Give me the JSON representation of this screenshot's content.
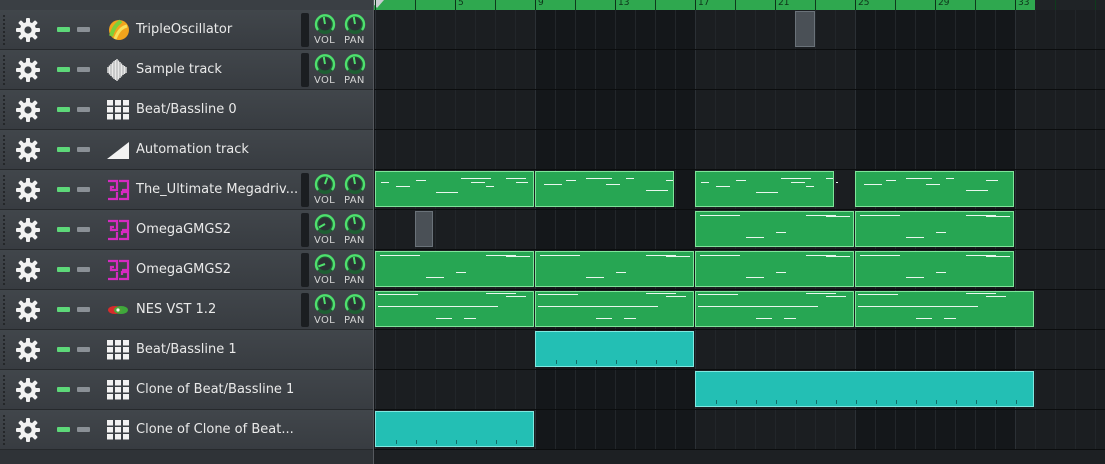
{
  "ruler": {
    "labels": [
      "5",
      "9",
      "13",
      "17",
      "21",
      "25",
      "29",
      "33"
    ]
  },
  "knob_labels": {
    "vol": "VOL",
    "pan": "PAN"
  },
  "colors": {
    "pattern_green": "#27a653",
    "pattern_teal": "#23bfb4",
    "mute_led": "#5dd879",
    "ruler_green": "#2fa84f"
  },
  "tracks": [
    {
      "name": "TripleOscillator",
      "icon": "triple-oscillator-icon",
      "knobs": true
    },
    {
      "name": "Sample track",
      "icon": "waveform-icon",
      "knobs": true
    },
    {
      "name": "Beat/Bassline 0",
      "icon": "beat-grid-icon",
      "knobs": false
    },
    {
      "name": "Automation track",
      "icon": "automation-ramp-icon",
      "knobs": false
    },
    {
      "name": "The_Ultimate Megadriv...",
      "icon": "vst-plugin-icon",
      "knobs": true
    },
    {
      "name": "OmegaGMGS2",
      "icon": "vst-plugin-icon",
      "knobs": true
    },
    {
      "name": "OmegaGMGS2",
      "icon": "vst-plugin-icon",
      "knobs": true
    },
    {
      "name": "NES VST 1.2",
      "icon": "nes-plugin-icon",
      "knobs": true
    },
    {
      "name": "Beat/Bassline 1",
      "icon": "beat-grid-icon",
      "knobs": false
    },
    {
      "name": "Clone of Beat/Bassline 1",
      "icon": "beat-grid-icon",
      "knobs": false
    },
    {
      "name": "Clone of Clone of Beat...",
      "icon": "beat-grid-icon",
      "knobs": false
    }
  ]
}
